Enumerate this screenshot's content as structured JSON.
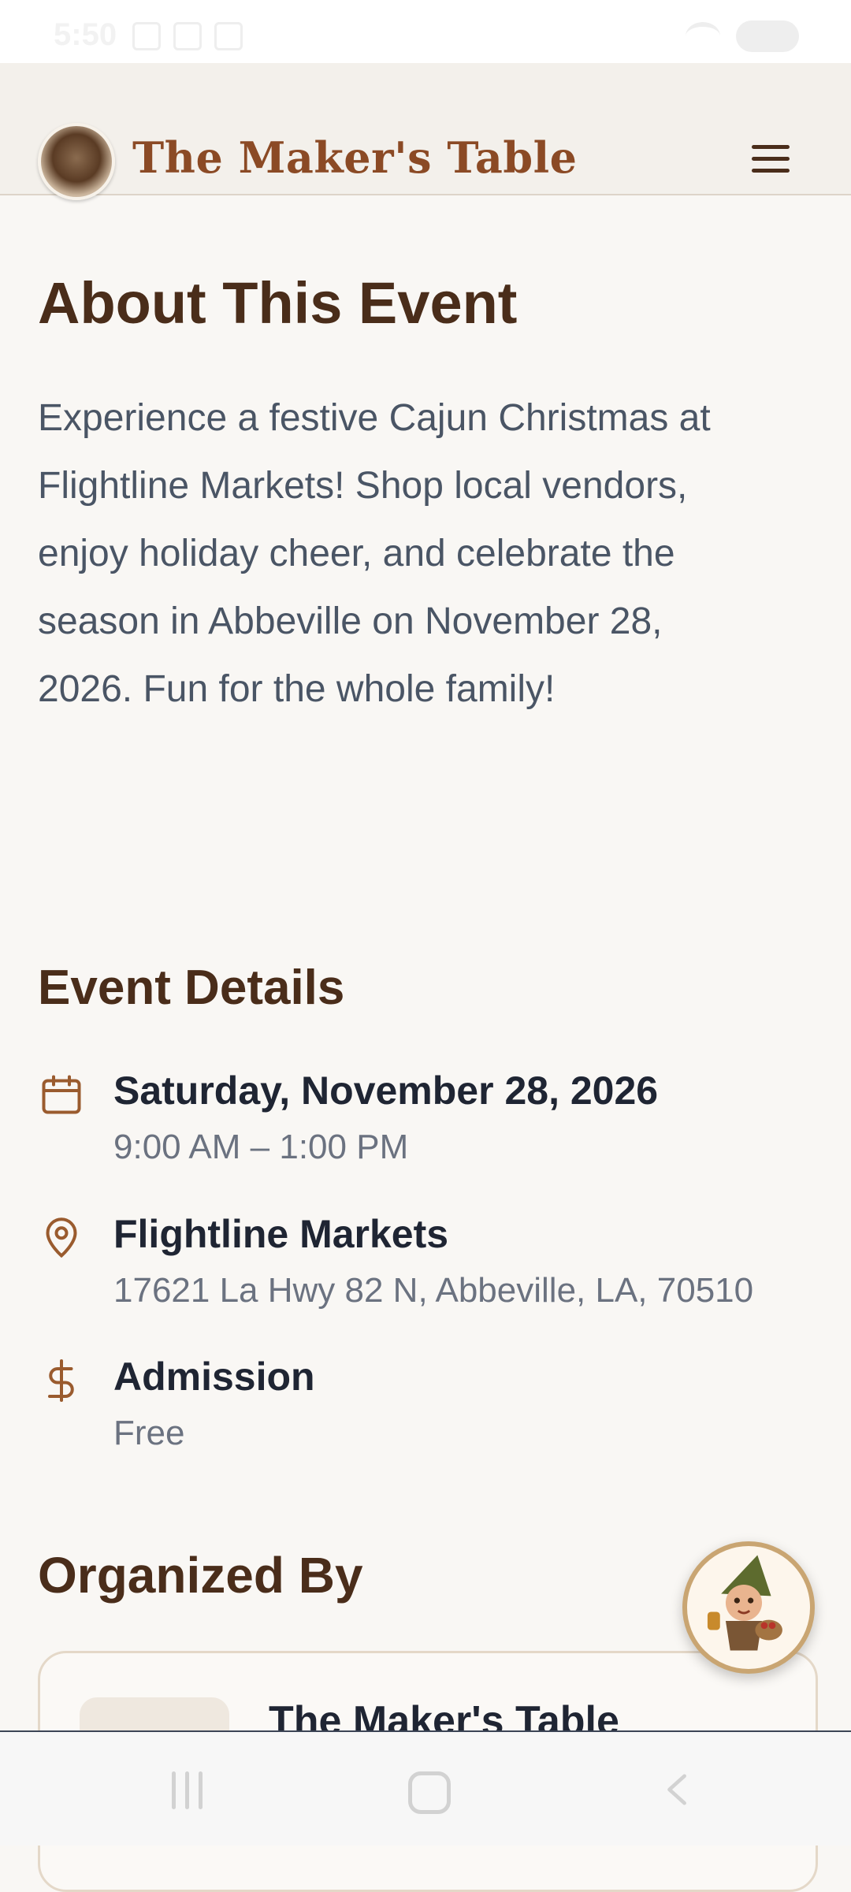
{
  "status_bar": {
    "time": "5:50"
  },
  "header": {
    "brand": "The Maker's Table"
  },
  "about": {
    "title": "About This Event",
    "lines": [
      "Experience a festive Cajun Christmas at",
      "Flightline Markets! Shop local vendors,",
      "enjoy holiday cheer, and celebrate the",
      "season in Abbeville on November 28,",
      "2026. Fun for the whole family!"
    ]
  },
  "details": {
    "title": "Event Details",
    "date": {
      "main": "Saturday, November 28, 2026",
      "sub": "9:00 AM – 1:00 PM",
      "icon": "calendar-icon"
    },
    "location": {
      "main": "Flightline Markets",
      "sub": "17621 La Hwy 82 N, Abbeville, LA, 70510",
      "icon": "map-pin-icon"
    },
    "admission": {
      "main": "Admission",
      "sub": "Free",
      "icon": "dollar-icon"
    }
  },
  "organizer": {
    "title": "Organized By",
    "name": "The Maker's Table"
  },
  "colors": {
    "brand": "#8b4a25",
    "heading": "#4a2d1a",
    "icon": "#9a5b2e",
    "background": "#f9f7f4"
  }
}
